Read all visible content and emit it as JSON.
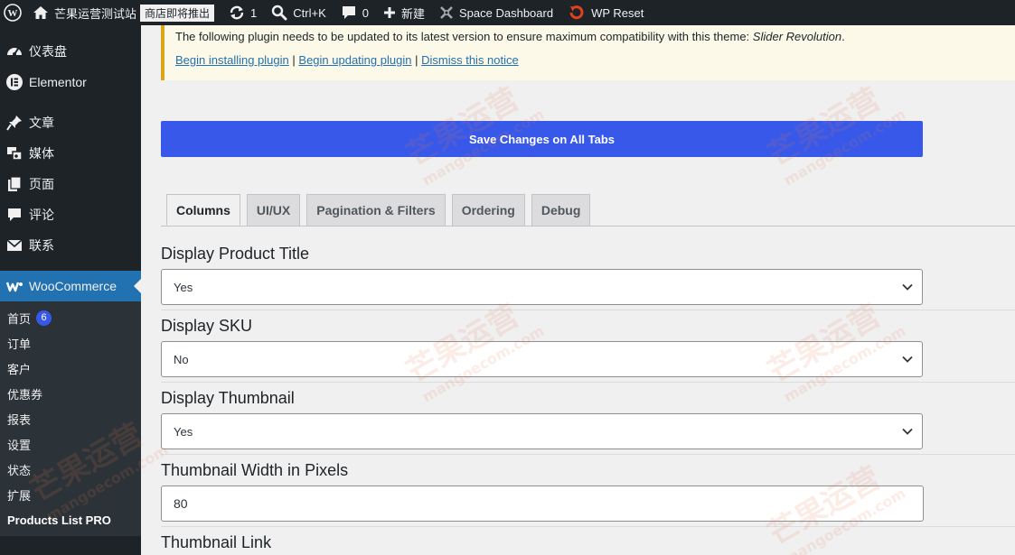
{
  "adminbar": {
    "site_name": "芒果运营测试站",
    "store_badge": "商店即将推出",
    "updates_count": "1",
    "search_shortcut": "Ctrl+K",
    "comments_count": "0",
    "new_label": "新建",
    "space_dashboard": "Space Dashboard",
    "wp_reset": "WP Reset"
  },
  "sidebar": {
    "items": [
      {
        "label": "仪表盘",
        "icon": "dashboard-icon"
      },
      {
        "label": "Elementor",
        "icon": "elementor-icon"
      },
      {
        "label": "文章",
        "icon": "pin-icon"
      },
      {
        "label": "媒体",
        "icon": "media-icon"
      },
      {
        "label": "页面",
        "icon": "pages-icon"
      },
      {
        "label": "评论",
        "icon": "comment-icon"
      },
      {
        "label": "联系",
        "icon": "mail-icon"
      },
      {
        "label": "WooCommerce",
        "icon": "woocommerce-icon"
      }
    ],
    "submenu": [
      {
        "label": "首页",
        "badge": "6"
      },
      {
        "label": "订单"
      },
      {
        "label": "客户"
      },
      {
        "label": "优惠券"
      },
      {
        "label": "报表"
      },
      {
        "label": "设置"
      },
      {
        "label": "状态"
      },
      {
        "label": "扩展"
      },
      {
        "label": "Products List PRO"
      }
    ]
  },
  "notice": {
    "text": "The following plugin needs to be updated to its latest version to ensure maximum compatibility with this theme: ",
    "plugin_name": "Slider Revolution",
    "text_end": ".",
    "link_install": "Begin installing plugin",
    "link_update": "Begin updating plugin",
    "link_dismiss": "Dismiss this notice",
    "separator": "|"
  },
  "save_button": "Save Changes on All Tabs",
  "tabs": [
    {
      "label": "Columns",
      "active": true
    },
    {
      "label": "UI/UX"
    },
    {
      "label": "Pagination & Filters"
    },
    {
      "label": "Ordering"
    },
    {
      "label": "Debug"
    }
  ],
  "fields": [
    {
      "label": "Display Product Title",
      "value": "Yes"
    },
    {
      "label": "Display SKU",
      "value": "No"
    },
    {
      "label": "Display Thumbnail",
      "value": "Yes"
    },
    {
      "label": "Thumbnail Width in Pixels",
      "value": "80"
    },
    {
      "label": "Thumbnail Link"
    }
  ],
  "watermark": {
    "cn": "芒果运营",
    "en": "mangoecom.com"
  },
  "colors": {
    "accent": "#3858e9",
    "sidebar_bg": "#1d2327",
    "active_menu": "#2271b1",
    "notice_border": "#dba617"
  }
}
